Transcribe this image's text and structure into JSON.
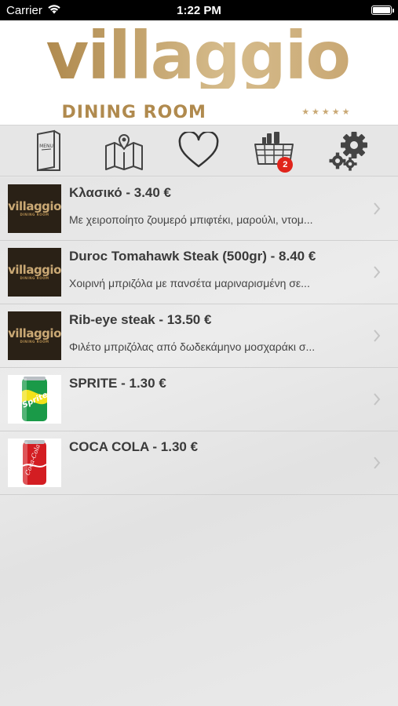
{
  "status": {
    "carrier": "Carrier",
    "time": "1:22 PM"
  },
  "header": {
    "logo_word": "villaggio",
    "logo_sub": "DINING ROOM",
    "logo_stars": "★★★★★"
  },
  "toolbar": {
    "menu_icon_text": "MENU",
    "cart_badge": "2",
    "badge_color": "#e0241b"
  },
  "colors": {
    "gold": "#b8975f",
    "brand_dark": "#2a2116"
  },
  "items": [
    {
      "title": "Κλασικό - 3.40 €",
      "desc": "Με χειροποίητο ζουμερό μπιφτέκι, μαρούλι, ντομ...",
      "thumb": "villaggio-logo"
    },
    {
      "title": "Duroc Tomahawk Steak (500gr) - 8.40 €",
      "desc": "Χοιρινή μπριζόλα με πανσέτα μαριναρισμένη σε...",
      "thumb": "villaggio-logo"
    },
    {
      "title": "Rib-eye steak - 13.50 €",
      "desc": "Φιλέτο μπριζόλας από δωδεκάμηνο μοσχαράκι σ...",
      "thumb": "villaggio-logo"
    },
    {
      "title": "SPRITE - 1.30 €",
      "desc": "",
      "thumb": "sprite-can",
      "can_label": "Sprite"
    },
    {
      "title": "COCA COLA - 1.30 €",
      "desc": "",
      "thumb": "coca-cola-can",
      "can_label": "Coca-Cola"
    }
  ],
  "thumb_logo": {
    "word": "villaggio",
    "sub": "DINING ROOM"
  }
}
